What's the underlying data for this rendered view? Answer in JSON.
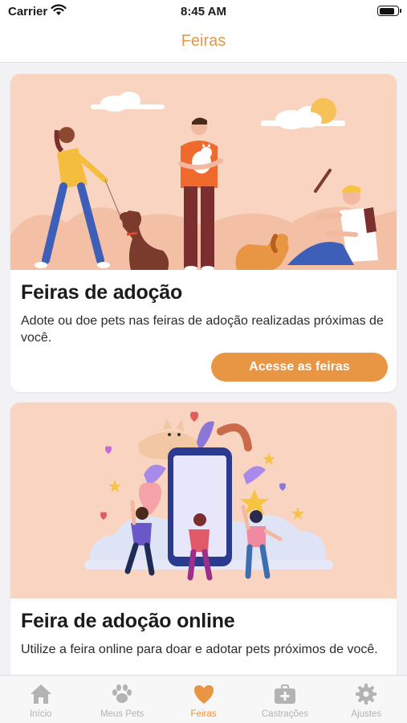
{
  "status_bar": {
    "carrier": "Carrier",
    "time": "8:45 AM",
    "battery_level": 0.9
  },
  "nav": {
    "title": "Feiras"
  },
  "cards": [
    {
      "title": "Feiras de adoção",
      "description": "Adote ou doe pets nas feiras de adoção realizadas próximas de você.",
      "button_label": "Acesse as feiras"
    },
    {
      "title": "Feira de adoção online",
      "description": "Utilize a feira online para doar e adotar pets próximos de você."
    }
  ],
  "tabs": [
    {
      "label": "Início",
      "icon": "house-icon",
      "active": false
    },
    {
      "label": "Meus Pets",
      "icon": "paw-icon",
      "active": false
    },
    {
      "label": "Feiras",
      "icon": "heart-icon",
      "active": true
    },
    {
      "label": "Castrações",
      "icon": "medical-kit-icon",
      "active": false
    },
    {
      "label": "Ajustes",
      "icon": "gear-icon",
      "active": false
    }
  ],
  "colors": {
    "accent": "#e89544",
    "inactive": "#b3b3b6",
    "illustration_bg": "#f9d5c1"
  }
}
